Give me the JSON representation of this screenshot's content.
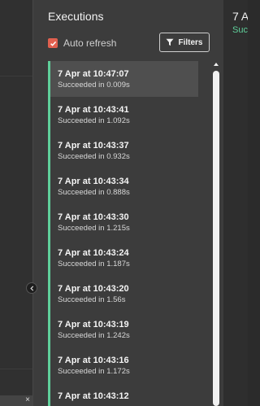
{
  "panel": {
    "title": "Executions",
    "auto_refresh_label": "Auto refresh",
    "auto_refresh_checked": true,
    "filters_label": "Filters"
  },
  "executions": [
    {
      "time": "7 Apr at 10:47:07",
      "status": "Succeeded in 0.009s",
      "selected": true
    },
    {
      "time": "7 Apr at 10:43:41",
      "status": "Succeeded in 1.092s"
    },
    {
      "time": "7 Apr at 10:43:37",
      "status": "Succeeded in 0.932s"
    },
    {
      "time": "7 Apr at 10:43:34",
      "status": "Succeeded in 0.888s"
    },
    {
      "time": "7 Apr at 10:43:30",
      "status": "Succeeded in 1.215s"
    },
    {
      "time": "7 Apr at 10:43:24",
      "status": "Succeeded in 1.187s"
    },
    {
      "time": "7 Apr at 10:43:20",
      "status": "Succeeded in 1.56s"
    },
    {
      "time": "7 Apr at 10:43:19",
      "status": "Succeeded in 1.242s"
    },
    {
      "time": "7 Apr at 10:43:16",
      "status": "Succeeded in 1.172s"
    },
    {
      "time": "7 Apr at 10:43:12",
      "status": ""
    }
  ],
  "detail": {
    "title_partial": "7 A",
    "status_partial": "Succ"
  },
  "left_rail": {
    "close_glyph": "×"
  },
  "colors": {
    "success": "#5fcf9a",
    "checkbox": "#e0604f"
  }
}
